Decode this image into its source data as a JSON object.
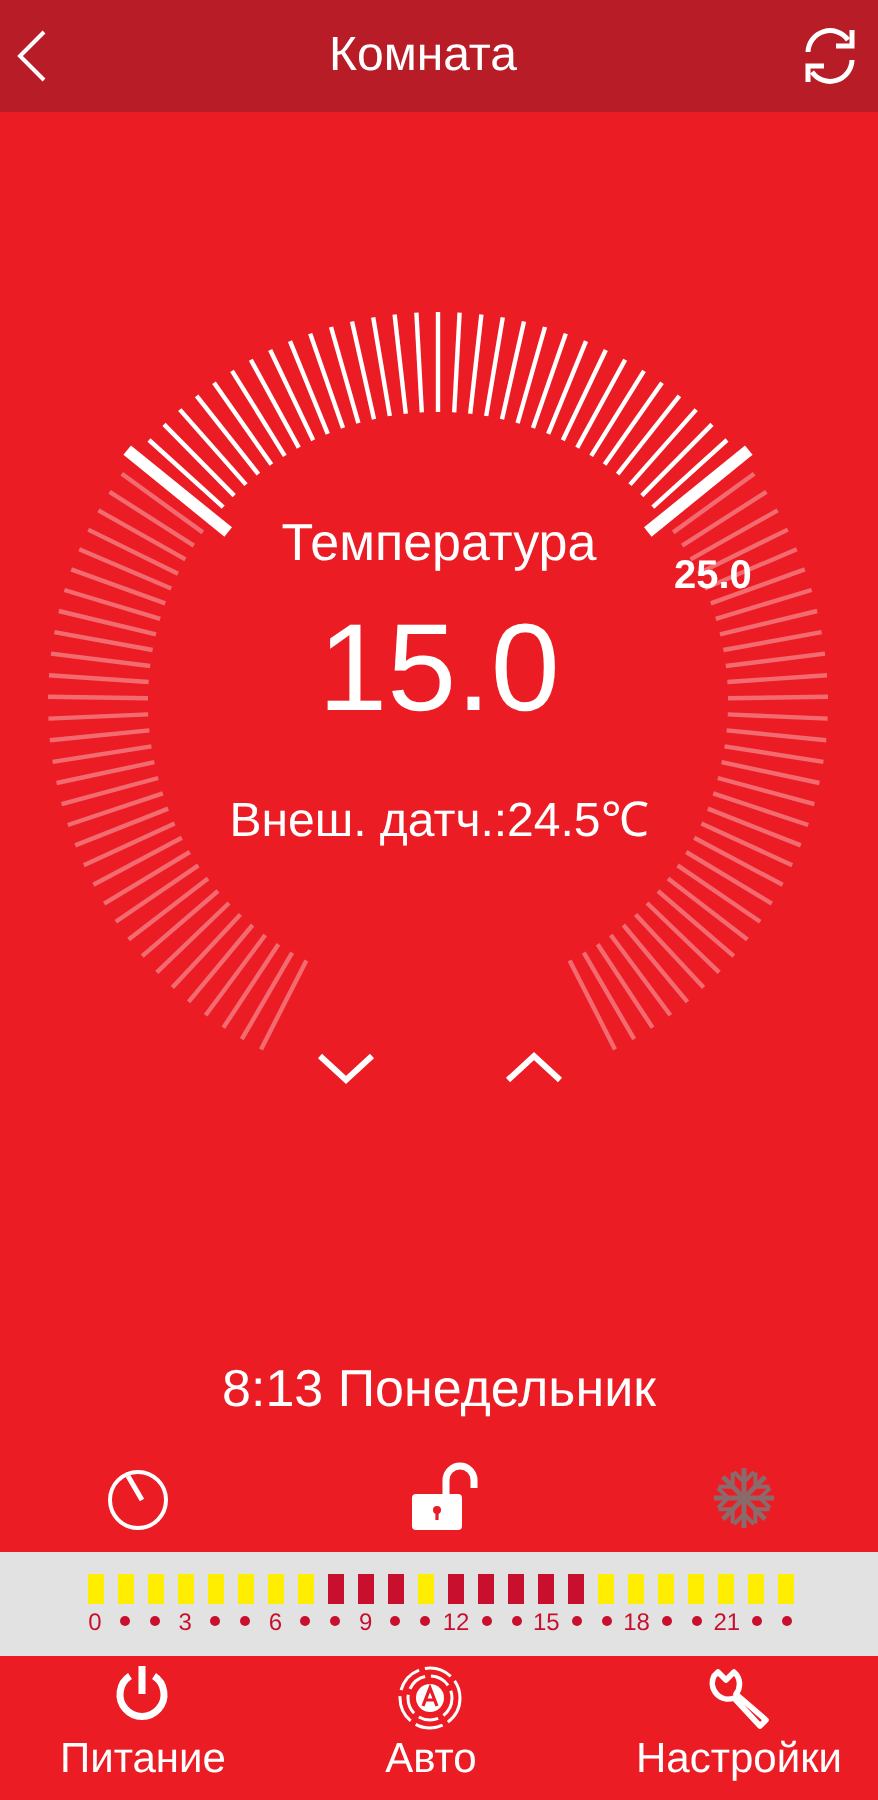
{
  "header": {
    "title": "Комната"
  },
  "dial": {
    "title": "Температура",
    "value": "15.0",
    "sensor": "Внеш. датч.:24.5℃",
    "limit_label": "25.0"
  },
  "clock": "8:13 Понедельник",
  "status_icons": {
    "lock": {
      "locked": false
    },
    "cooling": {
      "active": false
    }
  },
  "schedule": [
    {
      "color": "#ffee00",
      "label": "0"
    },
    {
      "color": "#ffee00"
    },
    {
      "color": "#ffee00"
    },
    {
      "color": "#ffee00",
      "label": "3"
    },
    {
      "color": "#ffee00"
    },
    {
      "color": "#ffee00"
    },
    {
      "color": "#ffee00",
      "label": "6"
    },
    {
      "color": "#ffee00"
    },
    {
      "color": "#c8102e"
    },
    {
      "color": "#c8102e",
      "label": "9"
    },
    {
      "color": "#c8102e"
    },
    {
      "color": "#ffee00"
    },
    {
      "color": "#c8102e",
      "label": "12"
    },
    {
      "color": "#c8102e"
    },
    {
      "color": "#c8102e"
    },
    {
      "color": "#c8102e",
      "label": "15"
    },
    {
      "color": "#c8102e"
    },
    {
      "color": "#ffee00"
    },
    {
      "color": "#ffee00",
      "label": "18"
    },
    {
      "color": "#ffee00"
    },
    {
      "color": "#ffee00"
    },
    {
      "color": "#ffee00",
      "label": "21"
    },
    {
      "color": "#ffee00"
    },
    {
      "color": "#ffee00"
    }
  ],
  "nav": [
    {
      "kind": "power",
      "label": "Питание"
    },
    {
      "kind": "auto",
      "label": "Авто"
    },
    {
      "kind": "settings",
      "label": "Настройки"
    }
  ]
}
